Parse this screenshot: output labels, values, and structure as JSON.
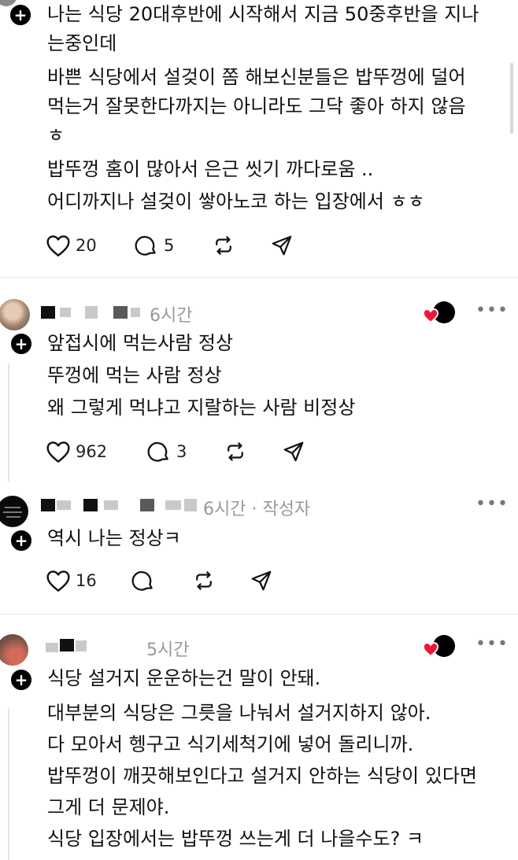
{
  "post": {
    "lines": [
      "나는 식당 20대후반에 시작해서 지금 50중후반을 지나",
      "는중인데",
      "바쁜 식당에서 설겆이 쫌 해보신분들은 밥뚜껑에 덜어",
      "먹는거  잘못한다까지는 아니라도 그닥 좋아 하지 않음",
      "ㅎ",
      "밥뚜껑 홈이 많아서 은근 씻기 까다로움 ..",
      "어디까지나 설겆이 쌓아노코 하는 입장에서  ㅎㅎ"
    ],
    "likes": "20",
    "replies": "5"
  },
  "comments": [
    {
      "time": "6시간",
      "lines": [
        "앞접시에 먹는사람 정상",
        "뚜껑에 먹는 사람 정상",
        "왜 그렇게 먹냐고 지랄하는 사람 비정상"
      ],
      "likes": "962",
      "replies": "3"
    },
    {
      "time": "6시간 · 작성자",
      "lines": [
        "역시 나는 정상ㅋ"
      ],
      "likes": "16"
    },
    {
      "time": "5시간",
      "lines": [
        "식당 설거지 운운하는건 말이 안돼.",
        "대부분의 식당은 그릇을 나눠서 설거지하지 않아.",
        "다 모아서 헹구고 식기세척기에 넣어 돌리니까.",
        "밥뚜껑이 깨끗해보인다고 설거지 안하는 식당이 있다면",
        "그게 더 문제야.",
        "식당 입장에서는 밥뚜껑 쓰는게 더 나을수도? ㅋ"
      ]
    }
  ],
  "ui": {
    "plus_glyph": "+",
    "more_glyph": "•••",
    "icons": [
      "heart-icon",
      "comment-icon",
      "repost-icon",
      "share-icon",
      "more-icon",
      "follow-plus-icon",
      "liked-by-author-icon"
    ],
    "colors": {
      "like_red": "#f0163a",
      "text": "#111111",
      "meta": "#999999"
    }
  }
}
